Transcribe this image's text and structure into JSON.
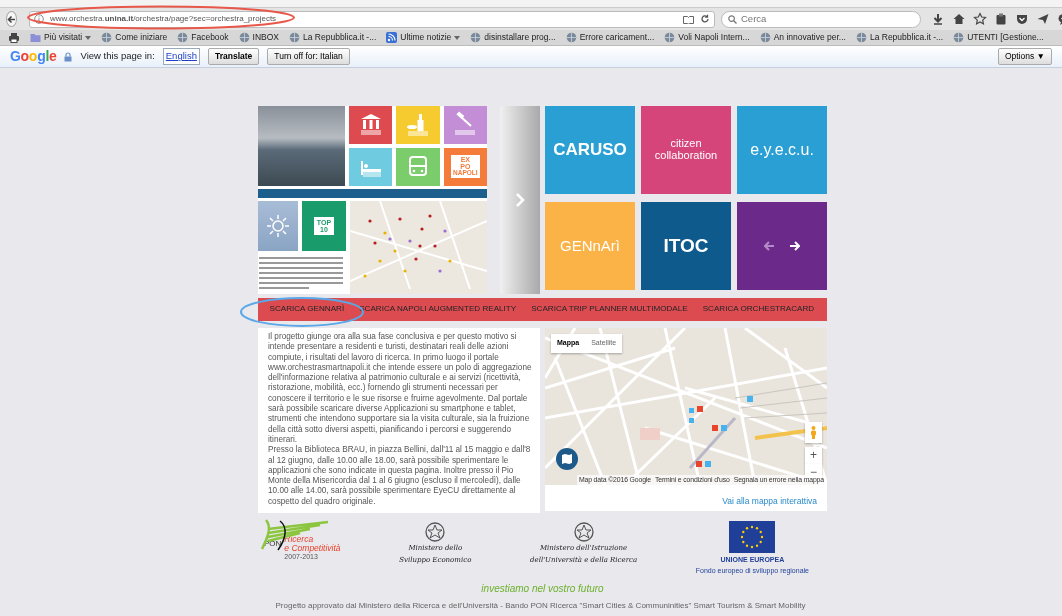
{
  "browser": {
    "url": "www.orchestra.**unina.it**/orchestra/page?sec=orchestra_projects",
    "search_placeholder": "Cerca",
    "bookmarks": [
      {
        "label": "Più visitati",
        "kind": "folder",
        "dropdown": true
      },
      {
        "label": "Come iniziare",
        "kind": "site",
        "dropdown": false
      },
      {
        "label": "Facebook",
        "kind": "site",
        "dropdown": false
      },
      {
        "label": "INBOX",
        "kind": "site",
        "dropdown": false
      },
      {
        "label": "La Repubblica.it -...",
        "kind": "site",
        "dropdown": false
      },
      {
        "label": "Ultime notizie",
        "kind": "feed",
        "dropdown": true
      },
      {
        "label": "disinstallare prog...",
        "kind": "site",
        "dropdown": false
      },
      {
        "label": "Errore caricament...",
        "kind": "site",
        "dropdown": false
      },
      {
        "label": "Voli Napoli Intern...",
        "kind": "site",
        "dropdown": false
      },
      {
        "label": "An innovative per...",
        "kind": "site",
        "dropdown": false
      },
      {
        "label": "La Repubblica.it -...",
        "kind": "site",
        "dropdown": false
      },
      {
        "label": "UTENTI [Gestione...",
        "kind": "site",
        "dropdown": false
      }
    ]
  },
  "translate_bar": {
    "logo": "Google",
    "prompt": "View this page in:",
    "language": "English",
    "translate": "Translate",
    "turn_off": "Turn off for: Italian",
    "options": "Options ▼"
  },
  "carousel": {
    "preview": {
      "expo": [
        "EX",
        "PO",
        "NAPOLI"
      ],
      "top": "TOP",
      "top_number": "10"
    },
    "tiles": [
      {
        "kind": "text",
        "label": "CARUSO",
        "color": "#2a9fd4"
      },
      {
        "kind": "text",
        "label": "citizen collaboration",
        "color": "#d5457a"
      },
      {
        "kind": "text",
        "label": "e.y.e.c.u.",
        "color": "#2a9fd4"
      },
      {
        "kind": "text",
        "label": "GENnArì",
        "color": "#fbb347"
      },
      {
        "kind": "text",
        "label": "ITOC",
        "color": "#0f5a8c"
      },
      {
        "kind": "nav",
        "color": "#6b2a89"
      }
    ]
  },
  "download_bar": [
    {
      "label": "SCARICA GENNARÌ"
    },
    {
      "label": "SCARICA NAPOLI AUGMENTED REALITY"
    },
    {
      "label": "SCARICA TRIP PLANNER MULTIMODALE"
    },
    {
      "label": "SCARICA ORCHESTRACARD"
    }
  ],
  "intro": {
    "before": "Il progetto giunge ora alla sua fase conclusiva e per questo motivo si intende presentare a residenti e turisti, destinatari reali delle azioni compiute, i risultati del lavoro di ricerca. In primo luogo il portale ",
    "link": "www.orchestrasmartnapoli.it",
    "after": " che intende essere un polo di aggregazione dell'informazione relativa al patrimonio culturale e ai servizi (ricettività, ristorazione, mobilità, ecc.) fornendo gli strumenti necessari per conoscere il territorio e le sue risorse e fruirne agevolmente. Dal portale sarà possibile scaricare diverse Applicazioni su smartphone e tablet, strumenti che intendono supportare sia la visita culturale, sia la fruizione della città sotto diversi aspetti, pianificando i percorsi e suggerendo itinerari.",
    "second": "Presso la Biblioteca BRAU, in piazza Bellini, dall'11 al 15 maggio e dall'8 al 12 giugno, dalle 10.00 alle 18.00, sarà possibile sperimentare le applicazioni che sono indicate in questa pagina. Inoltre presso il Pio Monte della Misericordia dal 1 al 6 giugno (escluso il mercoledì), dalle 10.00 alle 14.00, sarà possibile sperimentare EyeCU direttamente al cospetto del quadro originale."
  },
  "map": {
    "types": [
      {
        "label": "Mappa",
        "selected": true
      },
      {
        "label": "Satellite",
        "selected": false
      }
    ],
    "zoom_in": "+",
    "zoom_out": "−",
    "attribution": [
      "Map data ©2016 Google",
      "Termini e condizioni d'uso",
      "Segnala un errore nella mappa"
    ],
    "link": "Vai alla mappa interattiva"
  },
  "footer": {
    "pon": {
      "name": "PON",
      "lines": [
        "Ricerca",
        "e Competitività"
      ],
      "years": "2007-2013"
    },
    "ministries": [
      [
        "Ministero dello",
        "Sviluppo Economico"
      ],
      [
        "Ministero dell'Istruzione",
        "dell'Università e della Ricerca"
      ]
    ],
    "eu": [
      "UNIONE EUROPEA",
      "Fondo europeo di sviluppo regionale"
    ],
    "tagline": "investiamo nel vostro futuro",
    "note": "Progetto approvato dal Ministero della Ricerca e dell'Università - Bando PON Ricerca \"Smart Cities & Communinities\" Smart Tourism & Smart Mobility"
  }
}
